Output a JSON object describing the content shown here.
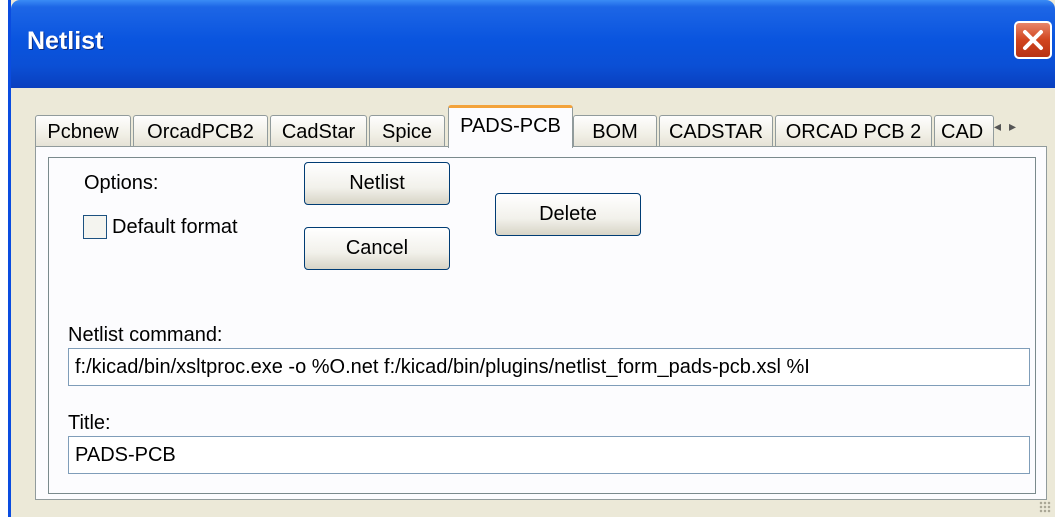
{
  "window": {
    "title": "Netlist"
  },
  "tabs": [
    {
      "label": "Pcbnew",
      "active": false
    },
    {
      "label": "OrcadPCB2",
      "active": false
    },
    {
      "label": "CadStar",
      "active": false
    },
    {
      "label": "Spice",
      "active": false
    },
    {
      "label": "PADS-PCB",
      "active": true
    },
    {
      "label": "BOM",
      "active": false
    },
    {
      "label": "CADSTAR",
      "active": false
    },
    {
      "label": "ORCAD PCB 2",
      "active": false
    },
    {
      "label": "CAD",
      "active": false
    }
  ],
  "tab_scroll": {
    "left_glyph": "◂",
    "right_glyph": "▸"
  },
  "options": {
    "label": "Options:",
    "default_format_label": "Default format",
    "default_format_checked": false
  },
  "buttons": {
    "netlist": "Netlist",
    "cancel": "Cancel",
    "delete": "Delete"
  },
  "command": {
    "label": "Netlist command:",
    "value": "f:/kicad/bin/xsltproc.exe -o %O.net f:/kicad/bin/plugins/netlist_form_pads-pcb.xsl %I"
  },
  "title_field": {
    "label": "Title:",
    "value": "PADS-PCB"
  },
  "colors": {
    "titlebar": "#0a55df",
    "dialog_bg": "#ece9d8",
    "active_tab_accent": "#f3a33b",
    "close_button": "#d1451f"
  }
}
